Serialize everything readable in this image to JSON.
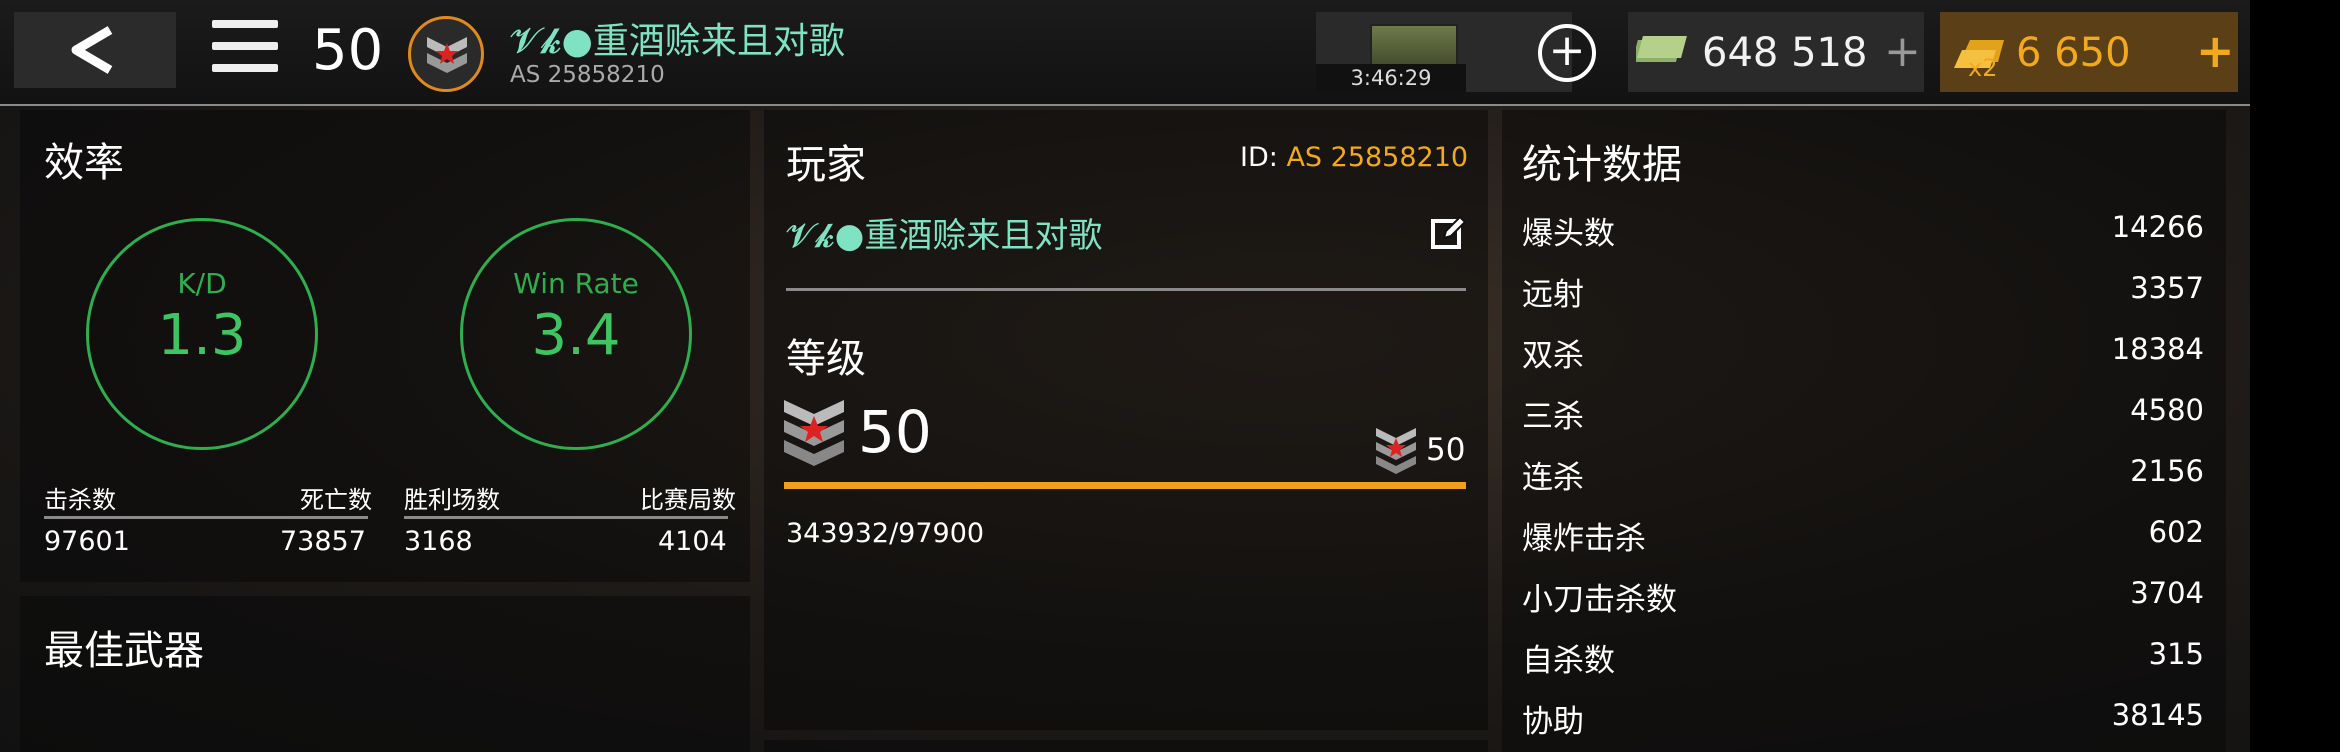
{
  "header": {
    "level": "50",
    "player_name": "𝓥𝓴●重酒赊来且对歌",
    "player_id": "AS 25858210",
    "crate_timer": "3:46:29",
    "cash": "648 518",
    "gold_multiplier": "x2",
    "gold": "6 650"
  },
  "efficiency": {
    "title": "效率",
    "kd_label": "K/D",
    "kd_value": "1.3",
    "winrate_label": "Win Rate",
    "winrate_value": "3.4",
    "kills_label": "击杀数",
    "deaths_label": "死亡数",
    "kills": "97601",
    "deaths": "73857",
    "wins_label": "胜利场数",
    "matches_label": "比赛局数",
    "wins": "3168",
    "matches": "4104"
  },
  "best_weapon": {
    "title": "最佳武器"
  },
  "player": {
    "title": "玩家",
    "id_prefix": "ID:",
    "id_value": "AS 25858210",
    "name": "𝓥𝓴●重酒赊来且对歌"
  },
  "rank": {
    "title": "等级",
    "level": "50",
    "next_level": "50",
    "xp": "343932/97900",
    "progress_fraction": 1.0
  },
  "stats": {
    "title": "统计数据",
    "rows": [
      {
        "label": "爆头数",
        "value": "14266"
      },
      {
        "label": "远射",
        "value": "3357"
      },
      {
        "label": "双杀",
        "value": "18384"
      },
      {
        "label": "三杀",
        "value": "4580"
      },
      {
        "label": "连杀",
        "value": "2156"
      },
      {
        "label": "爆炸击杀",
        "value": "602"
      },
      {
        "label": "小刀击杀数",
        "value": "3704"
      },
      {
        "label": "自杀数",
        "value": "315"
      },
      {
        "label": "协助",
        "value": "38145"
      }
    ]
  },
  "colors": {
    "accent_green": "#2fae4e",
    "accent_orange": "#f2a01a",
    "name_teal": "#7fe3c3"
  }
}
